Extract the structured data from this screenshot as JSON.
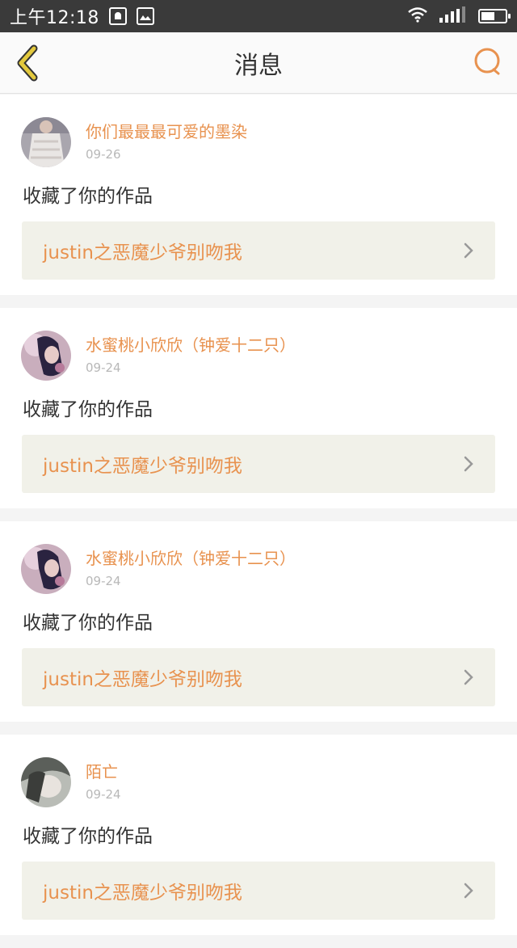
{
  "status_bar": {
    "time": "上午12:18"
  },
  "nav": {
    "title": "消息"
  },
  "messages": [
    {
      "username": "你们最最最可爱的墨染",
      "date": "09-26",
      "action": "收藏了你的作品",
      "work": "justin之恶魔少爷别吻我"
    },
    {
      "username": "水蜜桃小欣欣（钟爱十二只）",
      "date": "09-24",
      "action": "收藏了你的作品",
      "work": "justin之恶魔少爷别吻我"
    },
    {
      "username": "水蜜桃小欣欣（钟爱十二只）",
      "date": "09-24",
      "action": "收藏了你的作品",
      "work": "justin之恶魔少爷别吻我"
    },
    {
      "username": "陌亡",
      "date": "09-24",
      "action": "收藏了你的作品",
      "work": "justin之恶魔少爷别吻我"
    }
  ],
  "colors": {
    "accent": "#e8924f",
    "back_icon": "#e3c93e",
    "work_bg": "#f1f1e9"
  }
}
